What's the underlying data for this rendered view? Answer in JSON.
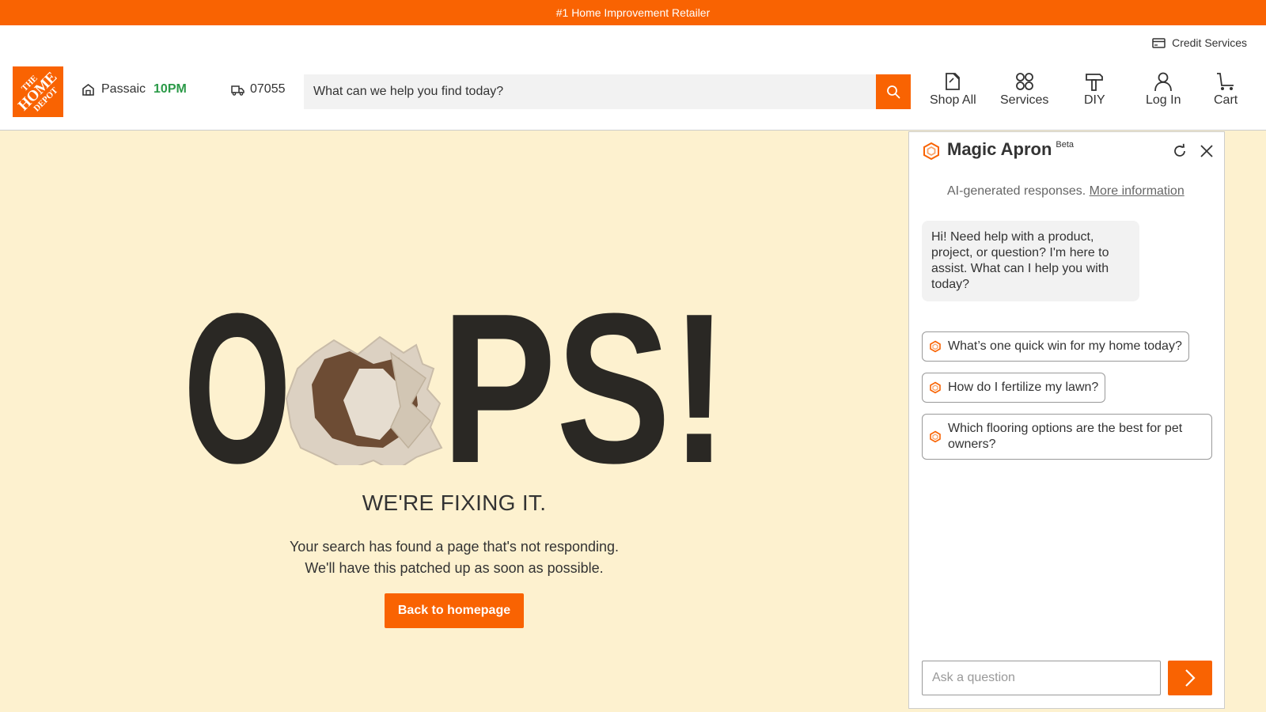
{
  "promo": {
    "text": "#1 Home Improvement Retailer"
  },
  "header": {
    "credit_services": "Credit Services",
    "logo": {
      "line1": "THE",
      "line2": "HOME",
      "line3": "DEPOT"
    },
    "store": {
      "name": "Passaic",
      "hours": "10PM"
    },
    "delivery_zip": "07055",
    "search": {
      "placeholder": "What can we help you find today?"
    },
    "nav": [
      {
        "label": "Shop All",
        "icon": "shop-all-icon"
      },
      {
        "label": "Services",
        "icon": "services-icon"
      },
      {
        "label": "DIY",
        "icon": "diy-icon"
      },
      {
        "label": "Log In",
        "icon": "user-icon"
      },
      {
        "label": "Cart",
        "icon": "cart-icon"
      }
    ]
  },
  "error": {
    "hero": {
      "letter1": "O",
      "rest": "PS!"
    },
    "heading": "WE'RE FIXING IT.",
    "line1": "Your search has found a page that's not responding.",
    "line2": "We'll have this patched up as soon as possible.",
    "button": "Back to homepage"
  },
  "assistant": {
    "title": "Magic Apron",
    "badge": "Beta",
    "disclaimer": "AI-generated responses.",
    "more_info": "More information",
    "greeting": "Hi! Need help with a product, project, or question? I'm here to assist. What can I help you with today?",
    "suggestions": [
      "What’s one quick win for my home today?",
      "How do I fertilize my lawn?",
      "Which flooring options are the best for pet owners?"
    ],
    "input_placeholder": "Ask a question"
  },
  "colors": {
    "brand": "#f96302",
    "hours": "#2b9a48",
    "error_bg": "#fdf1cf",
    "hero_text": "#2a2824"
  }
}
